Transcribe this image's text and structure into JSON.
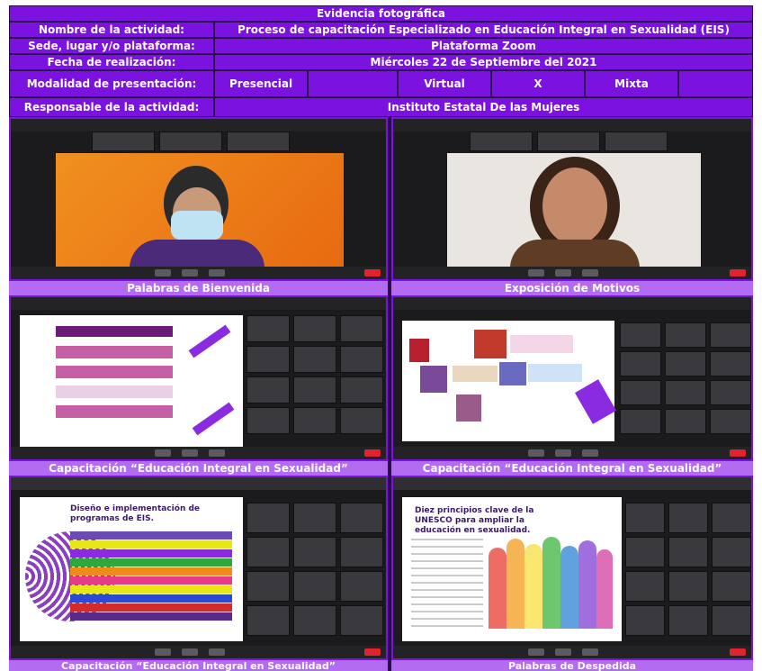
{
  "header": {
    "title": "Evidencia fotográfica",
    "rows": [
      {
        "label": "Nombre de la actividad:",
        "value": "Proceso de capacitación Especializado en Educación Integral en Sexualidad (EIS)"
      },
      {
        "label": "Sede, lugar y/o plataforma:",
        "value": "Plataforma Zoom"
      },
      {
        "label": "Fecha de realización:",
        "value": "Miércoles 22 de Septiembre del 2021"
      }
    ],
    "modalidad": {
      "label": "Modalidad de presentación:",
      "options": [
        "Presencial",
        "",
        "Virtual",
        "X",
        "Mixta",
        ""
      ]
    },
    "responsable": {
      "label": "Responsable de la actividad:",
      "value": "Instituto Estatal De las Mujeres"
    }
  },
  "captions": [
    "Palabras de Bienvenida",
    "Exposición de Motivos",
    "Capacitación “Educación Integral en Sexualidad”",
    "Capacitación “Educación Integral en Sexualidad”",
    "Capacitación “Educación Integral en Sexualidad”",
    "Palabras de Despedida"
  ],
  "slides": {
    "slide5_title": "Diseño e implementación de programas de EIS.",
    "slide6_title": "Diez principios clave de la UNESCO para ampliar la educación en sexualidad."
  },
  "colors": {
    "header_bg": "#7b12e0",
    "caption_bg": "#b36bf2",
    "border": "#2a0a4a",
    "zoom_bg": "#1b1b1d",
    "leave_button": "#e0242d"
  }
}
